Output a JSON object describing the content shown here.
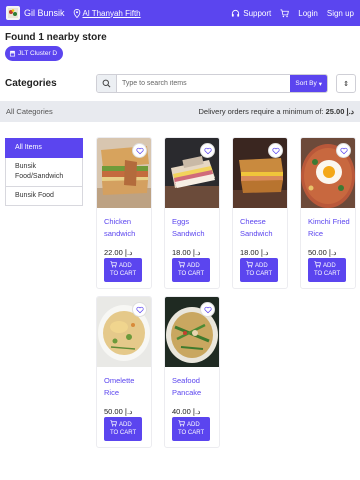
{
  "header": {
    "brand": "Gil Bunsik",
    "location": "Al Thanyah Fifth",
    "support": "Support",
    "login": "Login",
    "signup": "Sign up",
    "accent_color": "#5b45ef"
  },
  "store": {
    "found_text": "Found 1 nearby store",
    "cluster": "JLT Cluster D"
  },
  "categories_title": "Categories",
  "search": {
    "placeholder": "Type to search items",
    "sort_label": "Sort By",
    "order_icon": "sort-order-icon"
  },
  "info": {
    "all_categories": "All Categories",
    "minimum_text": "Delivery orders require a minimum of:",
    "minimum_value": "د.إ 25.00"
  },
  "sidebar": {
    "items": [
      {
        "label": "All Items",
        "active": true
      },
      {
        "label": "Bunsik Food/Sandwich",
        "active": false
      },
      {
        "label": "Bunsik Food",
        "active": false
      }
    ]
  },
  "products": [
    {
      "name": "Chicken sandwich",
      "price": "22.00 د.إ",
      "add": "ADD TO CART",
      "icon": "chicken-sandwich-photo"
    },
    {
      "name": "Eggs Sandwich",
      "price": "18.00 د.إ",
      "add": "ADD TO CART",
      "icon": "eggs-sandwich-photo"
    },
    {
      "name": "Cheese Sandwich",
      "price": "18.00 د.إ",
      "add": "ADD TO CART",
      "icon": "cheese-sandwich-photo"
    },
    {
      "name": "Kimchi Fried Rice",
      "price": "50.00 د.إ",
      "add": "ADD TO CART",
      "icon": "kimchi-fried-rice-photo"
    },
    {
      "name": "Omelette Rice",
      "price": "50.00 د.إ",
      "add": "ADD TO CART",
      "icon": "omelette-rice-photo"
    },
    {
      "name": "Seafood Pancake",
      "price": "40.00 د.إ",
      "add": "ADD TO CART",
      "icon": "seafood-pancake-photo"
    }
  ]
}
